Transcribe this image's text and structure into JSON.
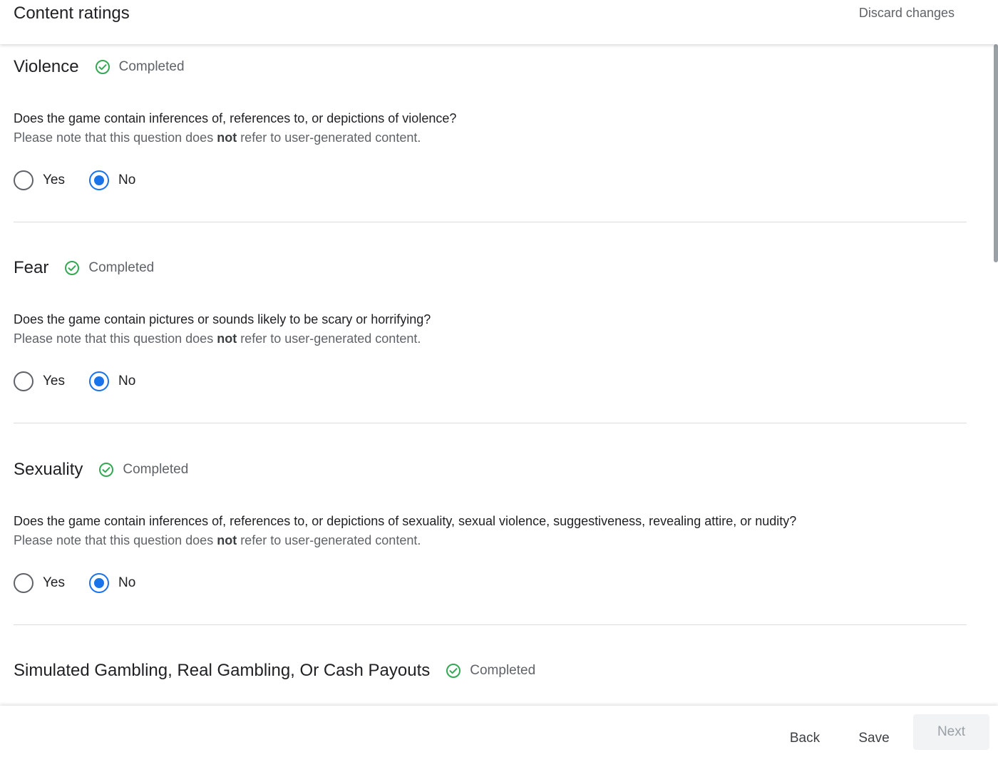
{
  "header": {
    "title": "Content ratings",
    "discard_label": "Discard changes"
  },
  "sections": [
    {
      "title": "Violence",
      "status": "Completed",
      "question": "Does the game contain inferences of, references to, or depictions of violence?",
      "note_prefix": "Please note that this question does ",
      "note_bold": "not",
      "note_suffix": " refer to user-generated content.",
      "options": [
        "Yes",
        "No"
      ],
      "selected": "No"
    },
    {
      "title": "Fear",
      "status": "Completed",
      "question": "Does the game contain pictures or sounds likely to be scary or horrifying?",
      "note_prefix": "Please note that this question does ",
      "note_bold": "not",
      "note_suffix": " refer to user-generated content.",
      "options": [
        "Yes",
        "No"
      ],
      "selected": "No"
    },
    {
      "title": "Sexuality",
      "status": "Completed",
      "question": "Does the game contain inferences of, references to, or depictions of sexuality, sexual violence, suggestiveness, revealing attire, or nudity?",
      "note_prefix": "Please note that this question does ",
      "note_bold": "not",
      "note_suffix": " refer to user-generated content.",
      "options": [
        "Yes",
        "No"
      ],
      "selected": "No"
    },
    {
      "title": "Simulated Gambling, Real Gambling, Or Cash Payouts",
      "status": "Completed"
    }
  ],
  "footer": {
    "back_label": "Back",
    "save_label": "Save",
    "next_label": "Next"
  },
  "colors": {
    "accent": "#1a73e8",
    "success": "#34a853"
  },
  "icons": {
    "status": "check-circle-icon"
  }
}
